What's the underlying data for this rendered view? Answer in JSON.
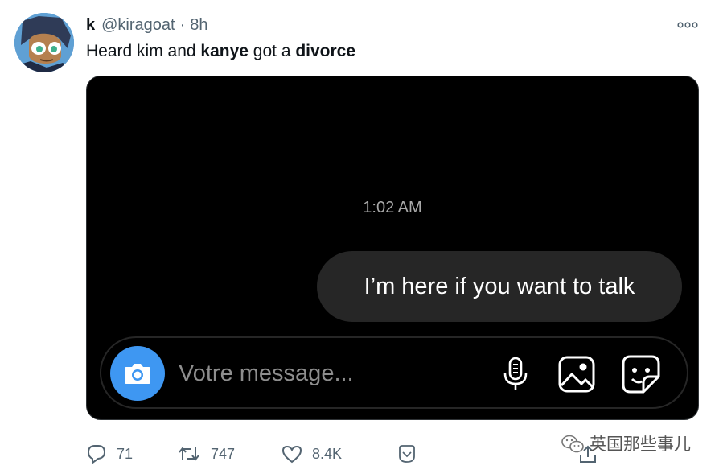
{
  "tweet": {
    "display_name": "k",
    "handle": "@kiragoat",
    "separator": "·",
    "time": "8h",
    "text_parts": [
      {
        "text": "Heard kim and ",
        "bold": false
      },
      {
        "text": "kanye",
        "bold": true
      },
      {
        "text": " got a ",
        "bold": false
      },
      {
        "text": "divorce",
        "bold": true
      }
    ]
  },
  "icons": {
    "avatar": "cartoon-avatar",
    "more": "more-options-icon",
    "camera": "camera-icon",
    "mic": "microphone-icon",
    "gallery": "gallery-icon",
    "sticker": "sticker-icon",
    "reply": "reply-icon",
    "retweet": "retweet-icon",
    "like": "heart-icon",
    "save": "bookmark-icon",
    "share": "share-icon",
    "wechat": "wechat-logo-icon"
  },
  "media": {
    "timestamp": "1:02 AM",
    "message": "I’m here if you want to talk",
    "composer_placeholder": "Votre message..."
  },
  "actions": {
    "replies": "71",
    "retweets": "747",
    "likes": "8.4K"
  },
  "watermark": {
    "text": "英国那些事儿"
  },
  "colors": {
    "accent_blue": "#3e97f2",
    "bubble": "#262626",
    "muted": "#536471"
  }
}
